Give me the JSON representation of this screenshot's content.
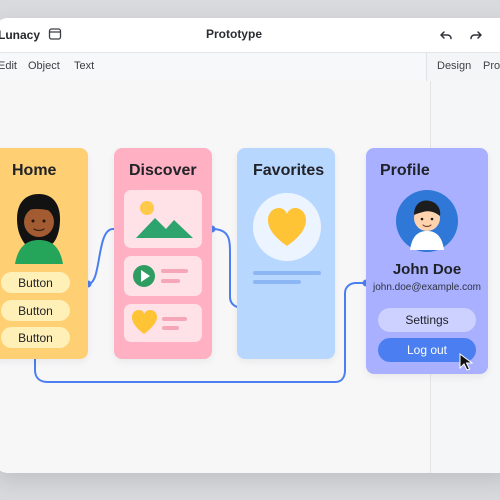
{
  "app": {
    "name": "Lunacy",
    "title": "Prototype"
  },
  "menu": {
    "edit": "Edit",
    "object": "Object",
    "text": "Text"
  },
  "panel_tabs": {
    "design": "Design",
    "prototype": "Prototype"
  },
  "screens": {
    "home": {
      "title": "Home",
      "buttons": [
        "Button",
        "Button",
        "Button"
      ]
    },
    "discover": {
      "title": "Discover"
    },
    "favorites": {
      "title": "Favorites"
    },
    "profile": {
      "title": "Profile",
      "name": "John Doe",
      "email": "john.doe@example.com",
      "settings": "Settings",
      "logout": "Log out"
    }
  },
  "icons": [
    "frame-icon",
    "undo-icon",
    "redo-icon",
    "mountain-image-icon",
    "play-icon",
    "heart-icon",
    "cursor-icon"
  ],
  "colors": {
    "home": "#ffd073",
    "discover": "#ffb0c2",
    "favorites": "#b8d7ff",
    "profile": "#a8b0ff",
    "connector": "#4b7ef0",
    "logout": "#4b7ef0"
  }
}
